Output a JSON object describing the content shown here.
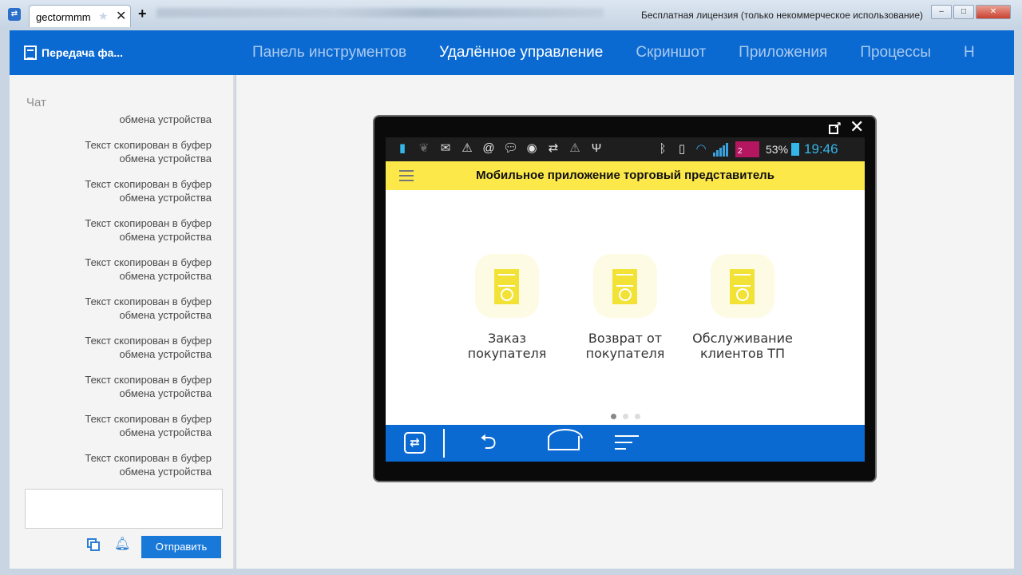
{
  "titlebar": {
    "tab_label": "gectormmm",
    "license_text": "Бесплатная лицензия (только некоммерческое использование)"
  },
  "header": {
    "file_transfer": "Передача фа...",
    "nav": [
      {
        "label": "Панель инструментов",
        "active": false
      },
      {
        "label": "Удалённое управление",
        "active": true
      },
      {
        "label": "Скриншот",
        "active": false
      },
      {
        "label": "Приложения",
        "active": false
      },
      {
        "label": "Процессы",
        "active": false
      },
      {
        "label": "Н",
        "active": false
      }
    ]
  },
  "chat": {
    "title": "Чат",
    "first_message": "обмена устройства",
    "messages": [
      "Текст скопирован в буфер обмена устройства",
      "Текст скопирован в буфер обмена устройства",
      "Текст скопирован в буфер обмена устройства",
      "Текст скопирован в буфер обмена устройства",
      "Текст скопирован в буфер обмена устройства",
      "Текст скопирован в буфер обмена устройства",
      "Текст скопирован в буфер обмена устройства",
      "Текст скопирован в буфер обмена устройства",
      "Текст скопирован в буфер обмена устройства"
    ],
    "message_line1": "Текст скопирован в буфер",
    "message_line2": "обмена устройства",
    "input_value": "",
    "send_label": "Отправить"
  },
  "device": {
    "status": {
      "battery_pct": "53%",
      "time": "19:46",
      "badge": "2"
    },
    "app_title": "Мобильное приложение торговый представитель",
    "tiles": [
      {
        "line1": "Заказ",
        "line2": "покупателя"
      },
      {
        "line1": "Возврат от",
        "line2": "покупателя"
      },
      {
        "line1": "Обслуживание",
        "line2": "клиентов ТП"
      }
    ],
    "page_dots": {
      "count": 3,
      "active_index": 0
    }
  },
  "colors": {
    "header_blue": "#0b6ad2",
    "app_bar_yellow": "#fde84a",
    "status_time": "#35b6e9"
  }
}
